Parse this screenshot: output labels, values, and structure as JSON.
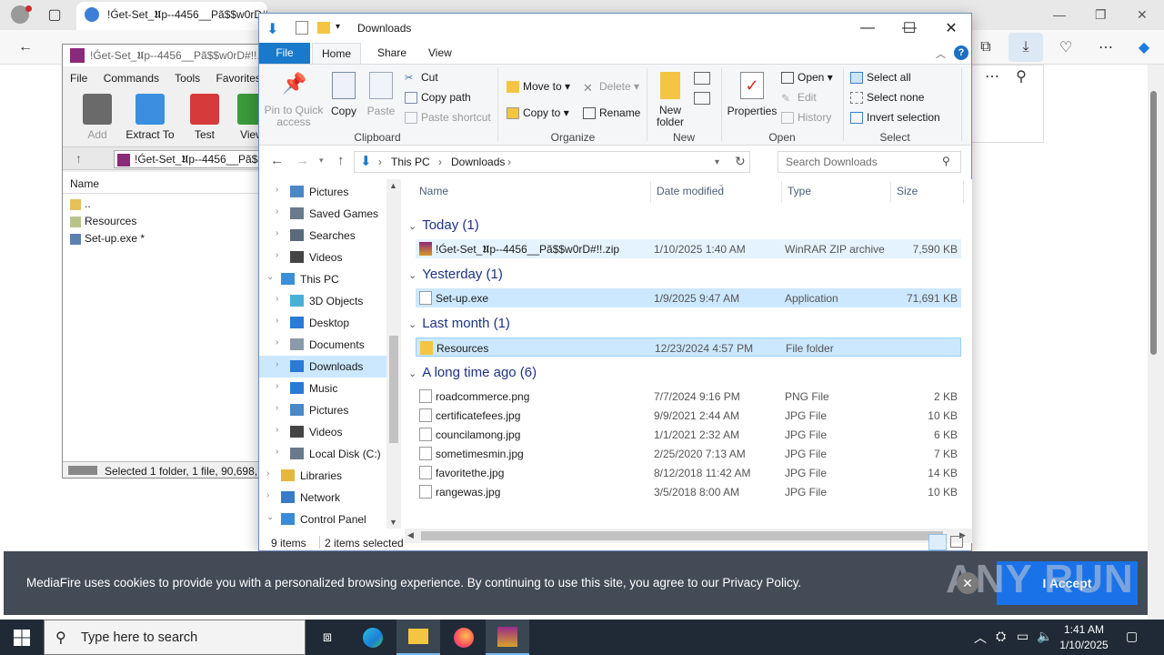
{
  "browser": {
    "tab_title": "!Ǵet-Set_𝖀p--4456__Pã$$w0rD#!!",
    "close_glyph": "×",
    "window_controls": {
      "minimize": "—",
      "restore": "❐",
      "close": "✕"
    }
  },
  "cookie_banner": {
    "message": "MediaFire uses cookies to provide you with a personalized browsing experience. By continuing to use this site, you agree to our Privacy Policy.",
    "accept_label": "I Accept",
    "close_glyph": "✕",
    "watermark": "ANY RUN"
  },
  "winrar": {
    "title": "!Ǵet-Set_𝖀p--4456__Pã$$w0rD#!!.zip",
    "menu": [
      "File",
      "Commands",
      "Tools",
      "Favorites"
    ],
    "tools": [
      "Add",
      "Extract To",
      "Test",
      "View"
    ],
    "address": "!Ǵet-Set_𝖀p--4456__Pã$$w0rD#!!.zip",
    "column_name": "Name",
    "rows": [
      "..",
      "Resources",
      "Set-up.exe *"
    ],
    "status": "Selected 1 folder, 1 file, 90,698,785 bytes"
  },
  "explorer": {
    "title": "Downloads",
    "ribbon_tabs": [
      "File",
      "Home",
      "Share",
      "View"
    ],
    "clipboard": {
      "pin": "Pin to Quick access",
      "copy": "Copy",
      "paste": "Paste",
      "cut": "Cut",
      "copy_path": "Copy path",
      "paste_shortcut": "Paste shortcut",
      "label": "Clipboard"
    },
    "organize": {
      "move_to": "Move to",
      "copy_to": "Copy to",
      "delete": "Delete",
      "rename": "Rename",
      "label": "Organize"
    },
    "new": {
      "new_folder": "New folder",
      "label": "New"
    },
    "open": {
      "properties": "Properties",
      "open": "Open",
      "edit": "Edit",
      "history": "History",
      "label": "Open"
    },
    "select": {
      "select_all": "Select all",
      "select_none": "Select none",
      "invert": "Invert selection",
      "label": "Select"
    },
    "breadcrumb": [
      "This PC",
      "Downloads"
    ],
    "search_placeholder": "Search Downloads",
    "columns": [
      "Name",
      "Date modified",
      "Type",
      "Size"
    ],
    "nav": [
      {
        "label": "Pictures",
        "indent": 2
      },
      {
        "label": "Saved Games",
        "indent": 2
      },
      {
        "label": "Searches",
        "indent": 2
      },
      {
        "label": "Videos",
        "indent": 2
      },
      {
        "label": "This PC",
        "indent": 1
      },
      {
        "label": "3D Objects",
        "indent": 2
      },
      {
        "label": "Desktop",
        "indent": 2
      },
      {
        "label": "Documents",
        "indent": 2
      },
      {
        "label": "Downloads",
        "indent": 2
      },
      {
        "label": "Music",
        "indent": 2
      },
      {
        "label": "Pictures",
        "indent": 2
      },
      {
        "label": "Videos",
        "indent": 2
      },
      {
        "label": "Local Disk (C:)",
        "indent": 2
      },
      {
        "label": "Libraries",
        "indent": 1
      },
      {
        "label": "Network",
        "indent": 1
      },
      {
        "label": "Control Panel",
        "indent": 1
      }
    ],
    "groups": [
      {
        "label": "Today (1)",
        "files": [
          {
            "name": "!Ǵet-Set_𝖀p--4456__Pã$$w0rD#!!.zip",
            "date": "1/10/2025 1:40 AM",
            "type": "WinRAR ZIP archive",
            "size": "7,590 KB",
            "icon": "zip-icon",
            "sel": "hover"
          }
        ]
      },
      {
        "label": "Yesterday (1)",
        "files": [
          {
            "name": "Set-up.exe",
            "date": "1/9/2025 9:47 AM",
            "type": "Application",
            "size": "71,691 KB",
            "icon": "exe-icon",
            "sel": "sel"
          }
        ]
      },
      {
        "label": "Last month (1)",
        "files": [
          {
            "name": "Resources",
            "date": "12/23/2024 4:57 PM",
            "type": "File folder",
            "size": "",
            "icon": "folder-icon",
            "sel": "focus"
          }
        ]
      },
      {
        "label": "A long time ago (6)",
        "files": [
          {
            "name": "roadcommerce.png",
            "date": "7/7/2024 9:16 PM",
            "type": "PNG File",
            "size": "2 KB",
            "icon": "image-file-icon",
            "sel": ""
          },
          {
            "name": "certificatefees.jpg",
            "date": "9/9/2021 2:44 AM",
            "type": "JPG File",
            "size": "10 KB",
            "icon": "image-file-icon",
            "sel": ""
          },
          {
            "name": "councilamong.jpg",
            "date": "1/1/2021 2:32 AM",
            "type": "JPG File",
            "size": "6 KB",
            "icon": "image-file-icon",
            "sel": ""
          },
          {
            "name": "sometimesmin.jpg",
            "date": "2/25/2020 7:13 AM",
            "type": "JPG File",
            "size": "7 KB",
            "icon": "image-file-icon",
            "sel": ""
          },
          {
            "name": "favoritethe.jpg",
            "date": "8/12/2018 11:42 AM",
            "type": "JPG File",
            "size": "14 KB",
            "icon": "image-file-icon",
            "sel": ""
          },
          {
            "name": "rangewas.jpg",
            "date": "3/5/2018 8:00 AM",
            "type": "JPG File",
            "size": "10 KB",
            "icon": "image-file-icon",
            "sel": ""
          }
        ]
      }
    ],
    "status_items": "9 items",
    "status_selected": "2 items selected"
  },
  "taskbar": {
    "search_placeholder": "Type here to search",
    "time": "1:41 AM",
    "date": "1/10/2025"
  }
}
